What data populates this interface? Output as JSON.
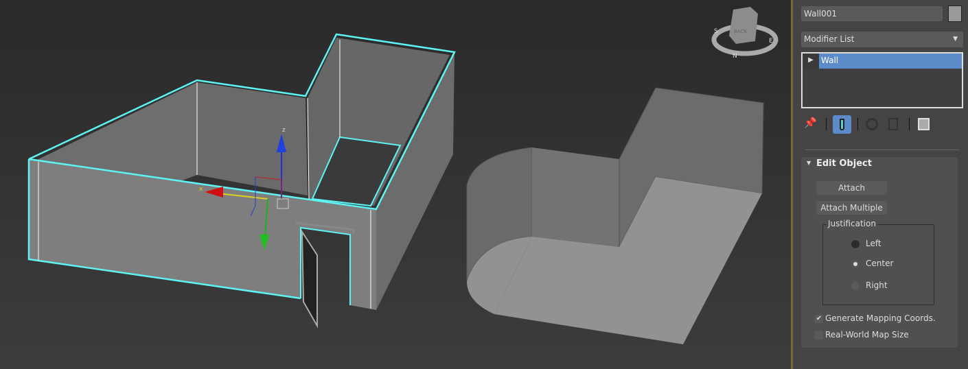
{
  "viewport": {
    "viewcube_face": "BACK",
    "compass_labels": [
      "N",
      "E",
      "S"
    ],
    "gizmo_axes": [
      "x",
      "z"
    ],
    "selection_color": "#5ff4f4"
  },
  "panel": {
    "object_name": "Wall001",
    "object_color": "#9a9a9a",
    "modifier_list": "Modifier List",
    "stack": [
      {
        "label": "Wall",
        "selected": true
      }
    ],
    "toolbar_icons": [
      "pin-icon",
      "show-end-result-icon",
      "make-unique-icon",
      "remove-modifier-icon",
      "configure-sets-icon"
    ],
    "rollout": {
      "title": "Edit Object",
      "attach": "Attach",
      "attach_multiple": "Attach Multiple",
      "justification": {
        "label": "Justification",
        "options": [
          "Left",
          "Center",
          "Right"
        ],
        "selected": "Center"
      },
      "generate_mapping": {
        "label": "Generate Mapping Coords.",
        "checked": true
      },
      "real_world": {
        "label": "Real-World Map Size",
        "checked": false
      }
    }
  }
}
